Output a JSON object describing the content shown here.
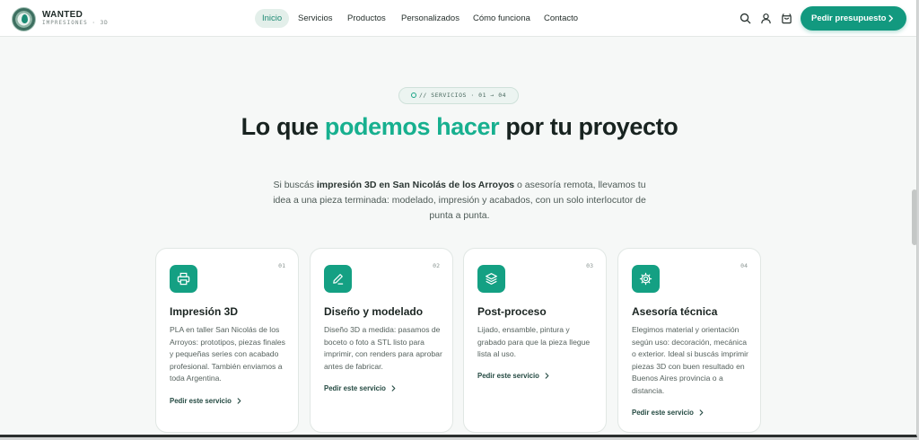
{
  "brand": {
    "name": "WANTED",
    "subtitle": "IMPRESIONES · 3D"
  },
  "nav": {
    "items": [
      {
        "label": "Inicio",
        "active": true
      },
      {
        "label": "Servicios",
        "active": false
      },
      {
        "label": "Productos",
        "active": false
      },
      {
        "label": "Personalizados",
        "active": false
      },
      {
        "label": "Cómo funciona",
        "active": false
      },
      {
        "label": "Contacto",
        "active": false
      }
    ]
  },
  "header_icons": [
    "search-icon",
    "user-icon",
    "cart-icon"
  ],
  "cta": {
    "label": "Pedir presupuesto"
  },
  "hero": {
    "badge": "// SERVICIOS · 01 → 04",
    "title_part1": "Lo que ",
    "title_highlight": "podemos hacer",
    "title_part2": " por tu proyecto",
    "lead_part1": "Si buscás ",
    "lead_bold": "impresión 3D en San Nicolás de los Arroyos",
    "lead_part2": " o asesoría remota, llevamos tu idea a una pieza terminada: modelado, impresión y acabados, con un solo interlocutor de punta a punta."
  },
  "cards": [
    {
      "num": "01",
      "icon": "printer-icon",
      "title": "Impresión 3D",
      "desc": "PLA en taller San Nicolás de los Arroyos: prototipos, piezas finales y pequeñas series con acabado profesional. También enviamos a toda Argentina.",
      "link": "Pedir este servicio"
    },
    {
      "num": "02",
      "icon": "pencil-icon",
      "title": "Diseño y modelado",
      "desc": "Diseño 3D a medida: pasamos de boceto o foto a STL listo para imprimir, con renders para aprobar antes de fabricar.",
      "link": "Pedir este servicio"
    },
    {
      "num": "03",
      "icon": "layers-icon",
      "title": "Post-proceso",
      "desc": "Lijado, ensamble, pintura y grabado para que la pieza llegue lista al uso.",
      "link": "Pedir este servicio"
    },
    {
      "num": "04",
      "icon": "gear-icon",
      "title": "Asesoría técnica",
      "desc": "Elegimos material y orientación según uso: decoración, mecánica o exterior. Ideal si buscás imprimir piezas 3D con buen resultado en Buenos Aires provincia o a distancia.",
      "link": "Pedir este servicio"
    }
  ],
  "colors": {
    "accent": "#12997f",
    "highlight": "#17b08f",
    "background": "#f6f8f7"
  }
}
